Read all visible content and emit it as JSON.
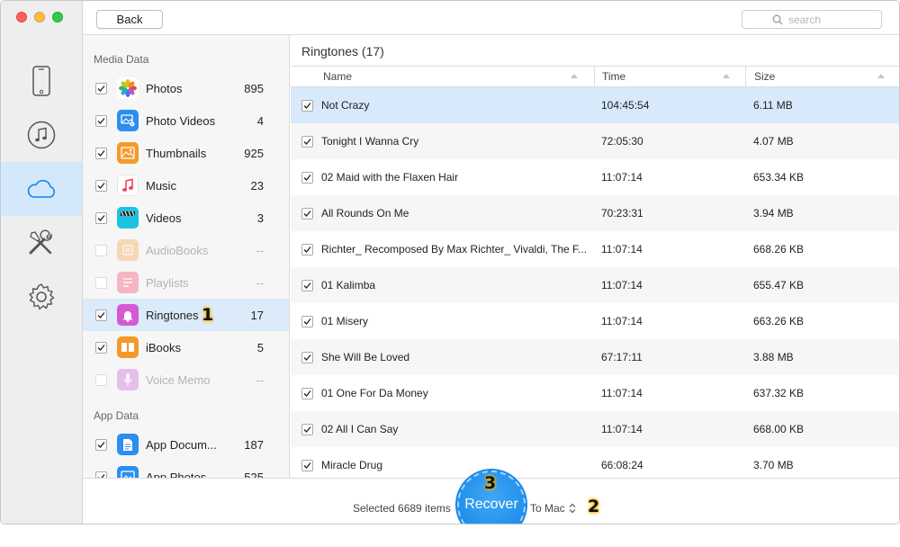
{
  "toolbar": {
    "back_label": "Back",
    "search_placeholder": "search"
  },
  "rail": {
    "items": [
      {
        "icon": "iphone-icon",
        "active": false
      },
      {
        "icon": "music-note-icon",
        "active": false
      },
      {
        "icon": "cloud-icon",
        "active": true
      },
      {
        "icon": "tools-icon",
        "active": false
      },
      {
        "icon": "gear-icon",
        "active": false
      }
    ]
  },
  "sidebar": {
    "media_heading": "Media Data",
    "app_heading": "App Data",
    "items": [
      {
        "label": "Photos",
        "count": "895",
        "checked": true,
        "enabled": true,
        "icon": "photos-app-icon"
      },
      {
        "label": "Photo Videos",
        "count": "4",
        "checked": true,
        "enabled": true,
        "icon": "photo-videos-app-icon"
      },
      {
        "label": "Thumbnails",
        "count": "925",
        "checked": true,
        "enabled": true,
        "icon": "thumbnails-app-icon"
      },
      {
        "label": "Music",
        "count": "23",
        "checked": true,
        "enabled": true,
        "icon": "music-app-icon"
      },
      {
        "label": "Videos",
        "count": "3",
        "checked": true,
        "enabled": true,
        "icon": "videos-app-icon"
      },
      {
        "label": "AudioBooks",
        "count": "--",
        "checked": false,
        "enabled": false,
        "icon": "audiobooks-app-icon"
      },
      {
        "label": "Playlists",
        "count": "--",
        "checked": false,
        "enabled": false,
        "icon": "playlists-app-icon"
      },
      {
        "label": "Ringtones",
        "count": "17",
        "checked": true,
        "enabled": true,
        "selected": true,
        "icon": "ringtones-app-icon",
        "badge": "1"
      },
      {
        "label": "iBooks",
        "count": "5",
        "checked": true,
        "enabled": true,
        "icon": "ibooks-app-icon"
      },
      {
        "label": "Voice Memo",
        "count": "--",
        "checked": false,
        "enabled": false,
        "icon": "voice-memo-app-icon"
      }
    ],
    "app_items": [
      {
        "label": "App Docum...",
        "count": "187",
        "checked": true,
        "icon": "app-documents-icon"
      },
      {
        "label": "App Photos",
        "count": "525",
        "checked": true,
        "icon": "app-photos-icon"
      }
    ]
  },
  "main": {
    "title": "Ringtones (17)",
    "columns": [
      "Name",
      "Time",
      "Size"
    ],
    "rows": [
      {
        "name": "Not Crazy",
        "time": "104:45:54",
        "size": "6.11 MB"
      },
      {
        "name": "Tonight I Wanna Cry",
        "time": "72:05:30",
        "size": "4.07 MB"
      },
      {
        "name": "02 Maid with the Flaxen Hair",
        "time": "11:07:14",
        "size": "653.34 KB"
      },
      {
        "name": "All Rounds On Me",
        "time": "70:23:31",
        "size": "3.94 MB"
      },
      {
        "name": "Richter_ Recomposed By Max Richter_ Vivaldi, The F...",
        "time": "11:07:14",
        "size": "668.26 KB"
      },
      {
        "name": "01 Kalimba",
        "time": "11:07:14",
        "size": "655.47 KB"
      },
      {
        "name": "01 Misery",
        "time": "11:07:14",
        "size": "663.26 KB"
      },
      {
        "name": "She Will Be Loved",
        "time": "67:17:11",
        "size": "3.88 MB"
      },
      {
        "name": "01 One For Da Money",
        "time": "11:07:14",
        "size": "637.32 KB"
      },
      {
        "name": "02 All I Can Say",
        "time": "11:07:14",
        "size": "668.00 KB"
      },
      {
        "name": "Miracle Drug",
        "time": "66:08:24",
        "size": "3.70 MB"
      }
    ]
  },
  "bottom": {
    "selected_text": "Selected 6689 items",
    "recover_label": "Recover",
    "recover_badge": "3",
    "destination": "To Mac",
    "destination_badge": "2"
  },
  "colors": {
    "accent": "#1586e6",
    "selection": "#d7e9fb",
    "badge_glow": "#f5b700"
  }
}
